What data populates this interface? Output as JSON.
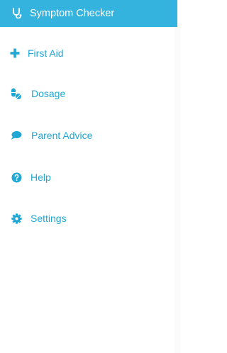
{
  "sidebar": {
    "items": [
      {
        "label": "Symptom Checker",
        "icon": "stethoscope-icon",
        "active": true
      },
      {
        "label": "First Aid",
        "icon": "plus-icon",
        "active": false
      },
      {
        "label": "Dosage",
        "icon": "pills-icon",
        "active": false
      },
      {
        "label": "Parent Advice",
        "icon": "speech-bubble-icon",
        "active": false
      },
      {
        "label": "Help",
        "icon": "question-circle-icon",
        "active": false
      },
      {
        "label": "Settings",
        "icon": "gear-icon",
        "active": false
      }
    ]
  },
  "colors": {
    "accent": "#34b3de",
    "text": "#21a7d3",
    "active_text": "#ffffff"
  }
}
